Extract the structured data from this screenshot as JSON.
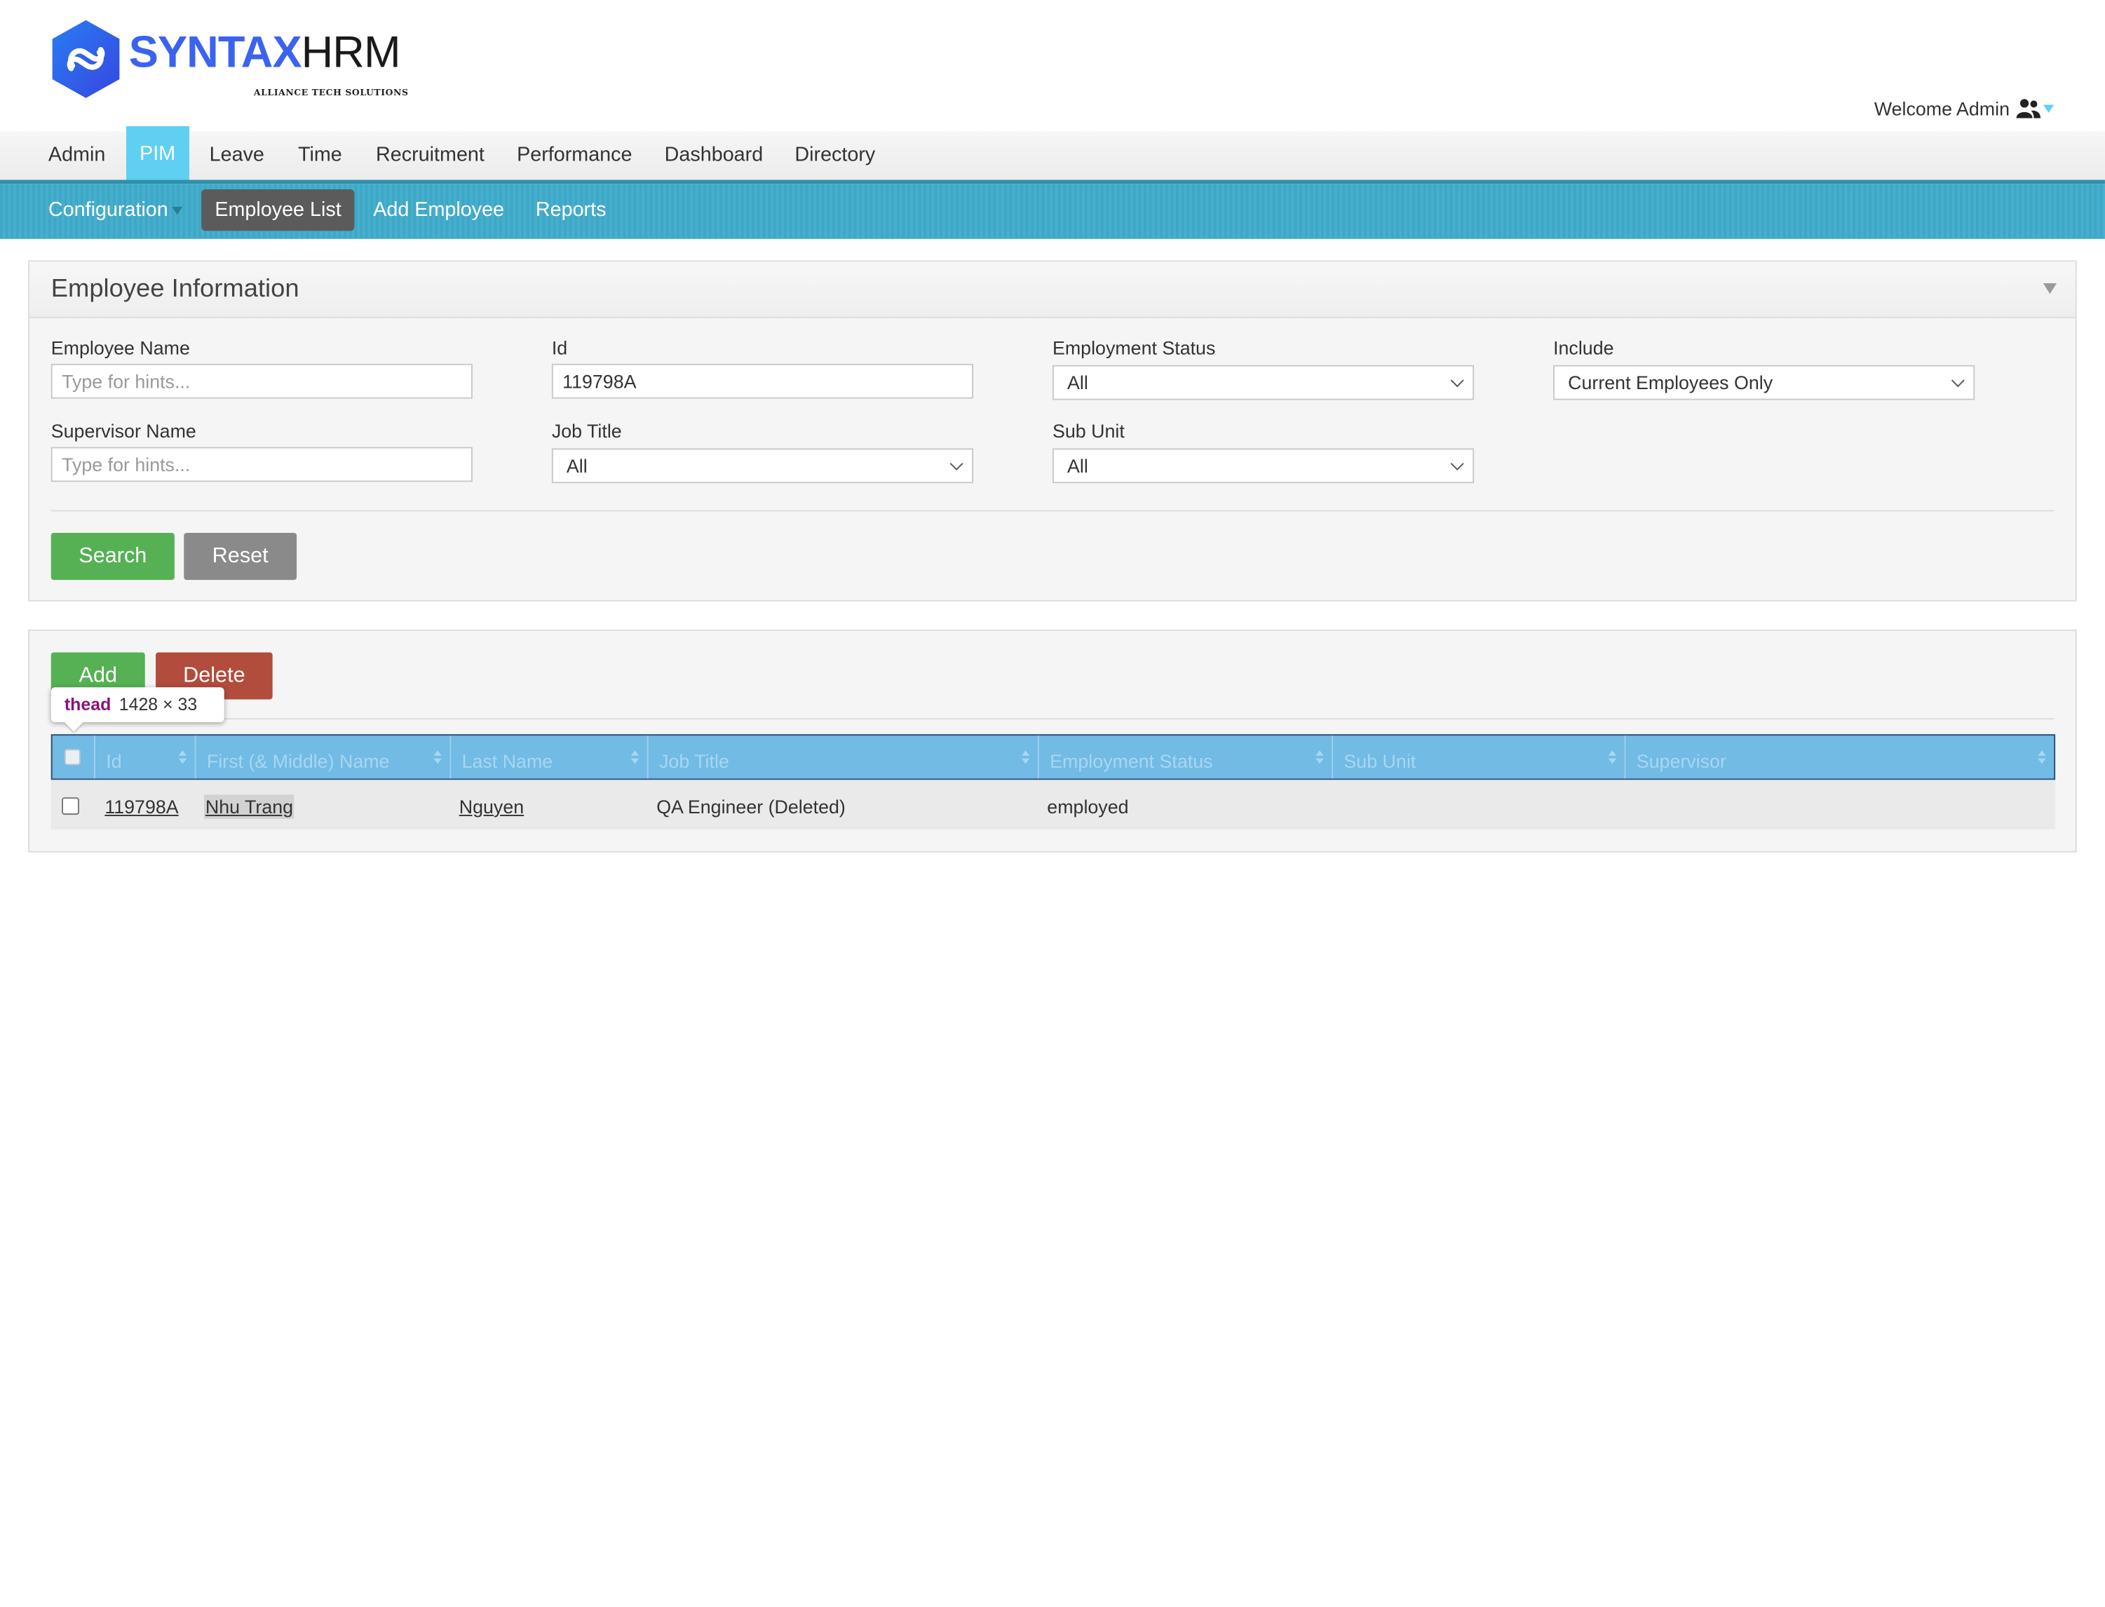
{
  "brand": {
    "name_part1": "SYNTAX",
    "name_part2": "HRM",
    "tagline": "ALLIANCE TECH SOLUTIONS",
    "color": "#3b63f0"
  },
  "welcome": {
    "text": "Welcome Admin",
    "icon": "users-icon"
  },
  "main_menu": {
    "items": [
      "Admin",
      "PIM",
      "Leave",
      "Time",
      "Recruitment",
      "Performance",
      "Dashboard",
      "Directory"
    ],
    "active": "PIM"
  },
  "sub_menu": {
    "items": [
      "Configuration",
      "Employee List",
      "Add Employee",
      "Reports"
    ],
    "active": "Employee List"
  },
  "search_panel": {
    "title": "Employee Information",
    "employee_name": {
      "label": "Employee Name",
      "value": "",
      "placeholder": "Type for hints..."
    },
    "id": {
      "label": "Id",
      "value": "119798A"
    },
    "employment_status": {
      "label": "Employment Status",
      "selected": "All"
    },
    "include": {
      "label": "Include",
      "selected": "Current Employees Only"
    },
    "supervisor_name": {
      "label": "Supervisor Name",
      "value": "",
      "placeholder": "Type for hints..."
    },
    "job_title": {
      "label": "Job Title",
      "selected": "All"
    },
    "sub_unit": {
      "label": "Sub Unit",
      "selected": "All"
    },
    "search_label": "Search",
    "reset_label": "Reset"
  },
  "results_panel": {
    "add_label": "Add",
    "delete_label": "Delete",
    "columns": [
      "Id",
      "First (& Middle) Name",
      "Last Name",
      "Job Title",
      "Employment Status",
      "Sub Unit",
      "Supervisor"
    ],
    "rows": [
      {
        "id": "119798A",
        "first_name": "Nhu Trang",
        "last_name": "Nguyen",
        "job_title": "QA Engineer (Deleted)",
        "employment_status": "employed",
        "sub_unit": "",
        "supervisor": ""
      }
    ]
  },
  "devtools_tooltip": {
    "tag": "thead",
    "dims": "1428 × 33"
  },
  "colors": {
    "menu_active": "#5fd0f2",
    "submenu_bg": "#3fa7c6",
    "submenu_active": "#5b5b5b",
    "table_header": "#71bbe5",
    "green_button": "#55b153",
    "gray_button": "#8a8a8a",
    "red_button": "#b24c3c"
  }
}
